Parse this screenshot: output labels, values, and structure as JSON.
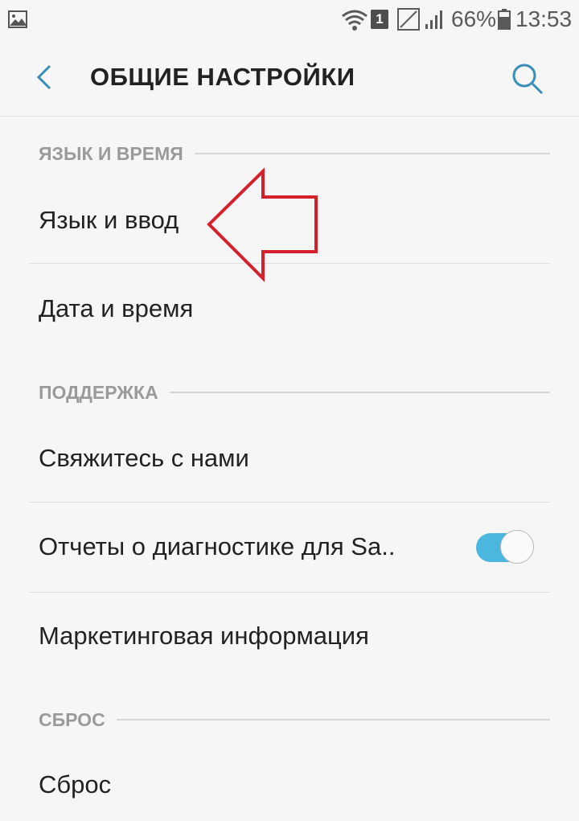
{
  "status_bar": {
    "sim_label": "1",
    "battery_percent": "66%",
    "time": "13:53"
  },
  "app_bar": {
    "title": "ОБЩИЕ НАСТРОЙКИ",
    "back_icon": "chevron-left-icon",
    "search_icon": "search-icon"
  },
  "sections": [
    {
      "header": "ЯЗЫК И ВРЕМЯ",
      "items": [
        "Язык и ввод",
        "Дата и время"
      ]
    },
    {
      "header": "ПОДДЕРЖКА",
      "items": [
        "Свяжитесь с нами",
        "Отчеты о диагностике для Sa..",
        "Маркетинговая информация"
      ]
    },
    {
      "header": "СБРОС",
      "items": [
        "Сброс"
      ]
    }
  ],
  "diagnostics_toggle": {
    "on": true
  },
  "colors": {
    "accent": "#4bb7df",
    "annotation": "#d6202b",
    "background": "#f6f6f6"
  }
}
